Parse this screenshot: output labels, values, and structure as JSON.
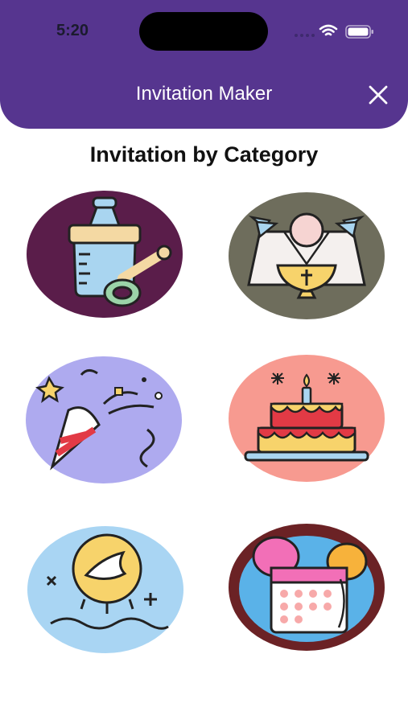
{
  "status_bar": {
    "time": "5:20"
  },
  "header": {
    "title": "Invitation Maker",
    "close_icon": "close-icon"
  },
  "section": {
    "title": "Invitation by Category"
  },
  "categories": [
    {
      "icon": "baby-bottle-pacifier-icon",
      "bg": "#5a1d4a"
    },
    {
      "icon": "christening-doves-icon",
      "bg": "#6e6d5c"
    },
    {
      "icon": "party-popper-icon",
      "bg": "#aeaaef"
    },
    {
      "icon": "birthday-cake-icon",
      "bg": "#f79a90"
    },
    {
      "icon": "dove-sunrise-icon",
      "bg": "#a9d5f3"
    },
    {
      "icon": "calendar-balloons-icon",
      "bg": "#6b2225"
    }
  ],
  "colors": {
    "header_bg": "#56358f",
    "title_text": "#ffffff"
  }
}
